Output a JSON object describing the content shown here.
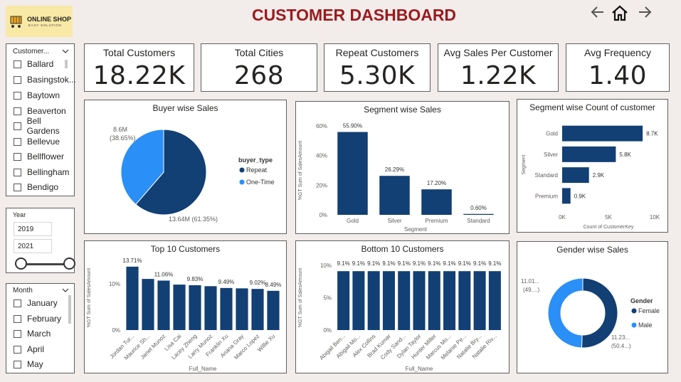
{
  "header": {
    "title": "CUSTOMER DASHBOARD",
    "logo_text": "ONLINE SHOP",
    "logo_sub": "EASY SOLUTION",
    "nav_icons": [
      "back-arrow-icon",
      "home-icon",
      "forward-arrow-icon"
    ]
  },
  "colors": {
    "dark_blue": "#123f74",
    "light_blue": "#2a8ff7",
    "title_red": "#9b1a1e"
  },
  "kpis": [
    {
      "label": "Total Customers",
      "value": "18.22K"
    },
    {
      "label": "Total Cities",
      "value": "268"
    },
    {
      "label": "Repeat Customers",
      "value": "5.30K"
    },
    {
      "label": "Avg Sales Per Customer",
      "value": "1.22K"
    },
    {
      "label": "Avg Frequency",
      "value": "1.40"
    }
  ],
  "city_slicer": {
    "header": "Customer...",
    "items": [
      "Ballard",
      "Basingstok...",
      "Baytown",
      "Beaverton",
      "Bell Gardens",
      "Bellevue",
      "Bellflower",
      "Bellingham",
      "Bendigo"
    ]
  },
  "year_slicer": {
    "label": "Year",
    "from": "2019",
    "to": "2021"
  },
  "month_slicer": {
    "label": "Month",
    "items": [
      "January",
      "February",
      "March",
      "April",
      "May"
    ]
  },
  "chart_data": [
    {
      "type": "pie",
      "title": "Buyer wise Sales",
      "legend_title": "buyer_type",
      "categories": [
        "Repeat",
        "One-Time"
      ],
      "values": [
        13.64,
        8.6
      ],
      "labels": [
        "13.64M (61.35%)",
        "8.6M (38.65%)"
      ],
      "legend": "right"
    },
    {
      "type": "bar",
      "title": "Segment wise Sales",
      "categories": [
        "Gold",
        "Silver",
        "Premium",
        "Standard"
      ],
      "values": [
        55.9,
        26.29,
        17.2,
        0.6
      ],
      "labels": [
        "55.90%",
        "26.29%",
        "17.20%",
        "0.60%"
      ],
      "xlabel": "Segment",
      "ylabel": "%GT Sum of SalesAmount",
      "yticks": [
        "0%",
        "20%",
        "40%",
        "60%"
      ],
      "ylim": [
        0,
        60
      ]
    },
    {
      "type": "bar",
      "orientation": "horizontal",
      "title": "Segment wise Count of customer",
      "categories": [
        "Gold",
        "Silver",
        "Standard",
        "Premium"
      ],
      "values": [
        8.7,
        5.8,
        2.9,
        0.9
      ],
      "labels": [
        "8.7K",
        "5.8K",
        "2.9K",
        "0.9K"
      ],
      "xlabel": "Count of CustomerKey",
      "ylabel": "Segment",
      "xticks": [
        "0K",
        "5K",
        "10K"
      ],
      "xlim": [
        0,
        10
      ]
    },
    {
      "type": "bar",
      "title": "Top 10 Customers",
      "categories": [
        "Jordan Tur...",
        "Maurice Sh...",
        "Janet Munoz",
        "Lisa Cai",
        "Lacey Zheng",
        "Larry Munoz",
        "Franklin Xu",
        "Ariana Gray",
        "Marco Lopez",
        "Willie Xu"
      ],
      "values": [
        13.71,
        11.06,
        10.7,
        9.83,
        9.7,
        9.49,
        9.1,
        9.02,
        8.9,
        8.49
      ],
      "labels": [
        "13.71%",
        "",
        "11.06%",
        "",
        "9.83%",
        "",
        "9.49%",
        "",
        "9.02%",
        "8.49%"
      ],
      "xlabel": "Full_Name",
      "ylabel": "%GT Sum of SalesAmount",
      "yticks": [
        "0%",
        "10%"
      ],
      "ylim": [
        0,
        14
      ]
    },
    {
      "type": "bar",
      "title": "Bottom 10 Customers",
      "categories": [
        "Abigail Ben...",
        "Abigail Mo...",
        "Alex Collins",
        "Brad Kumar",
        "Cody Sand...",
        "Dylan Taylor",
        "Hunter Miller",
        "Marcus Mo...",
        "Melanie Pe...",
        "Natalie Bry...",
        "Natalie Riv..."
      ],
      "values": [
        9.1,
        9.1,
        9.1,
        9.1,
        9.1,
        9.1,
        9.1,
        9.1,
        9.1,
        9.1,
        9.1
      ],
      "labels": [
        "9.1%",
        "9.1%",
        "9.1%",
        "9.1%",
        "9.1%",
        "9.1%",
        "9.1%",
        "9.1%",
        "9.1%",
        "9.1%",
        "9.1%"
      ],
      "xlabel": "Full_Name",
      "ylabel": "%GT Sum of SalesAmount",
      "yticks": [
        "0%",
        "5%",
        "10%"
      ],
      "ylim": [
        0,
        10
      ]
    },
    {
      "type": "pie",
      "donut": true,
      "title": "Gender wise Sales",
      "legend_title": "Gender",
      "categories": [
        "Female",
        "Male"
      ],
      "values": [
        11.23,
        11.01
      ],
      "labels": [
        "11.23... (50.4...)",
        "11.01... (49....)"
      ],
      "legend": "right"
    }
  ]
}
